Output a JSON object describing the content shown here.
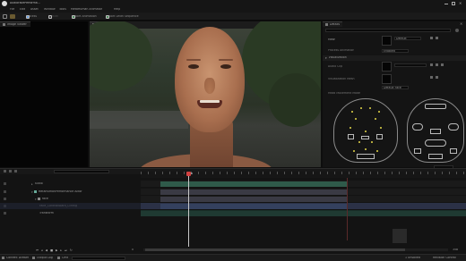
{
  "titlebar": {
    "tab_label": "AudioFacePerforma..."
  },
  "menu": {
    "items": [
      "File",
      "Edit",
      "Asset",
      "Window",
      "Tools",
      "MetaHuman Animator",
      "Help"
    ]
  },
  "toolbar": {
    "buttons": [
      {
        "label": "Process",
        "color": "#6aa0e0"
      },
      {
        "label": "Cancel",
        "color": "#555555"
      },
      {
        "label": "Export Animation",
        "color": "#9a9a9a"
      },
      {
        "label": "Export Level Sequence",
        "color": "#9a9a9a"
      }
    ]
  },
  "panels": {
    "image_viewer": "Image Viewer",
    "viewport": "A/B Viewport",
    "details": "Details"
  },
  "details": {
    "rows": [
      {
        "label": "Mesh",
        "value": "Default"
      },
      {
        "label": "Process Animation",
        "value": "Enabled"
      },
      {
        "label": "Visualization",
        "value": ""
      },
      {
        "label": "Audio Clip",
        "value": ""
      },
      {
        "label": "Visualization Mesh",
        "value": "Default Face"
      },
      {
        "label": "Head Movement Mode",
        "value": ""
      }
    ],
    "section": "Visualization"
  },
  "sequencer": {
    "frame_marker": "0",
    "tracks": [
      {
        "label": "Audio"
      },
      {
        "label": "MetaHumanPerformance Actor"
      },
      {
        "label": "Face"
      },
      {
        "label": "Face_ControlBoard_CtrlRig"
      },
      {
        "label": "Transform"
      }
    ],
    "start_frame": "0",
    "end_frame": "358"
  },
  "status": {
    "items": [
      "Content Drawer",
      "Output Log",
      "Cmd"
    ],
    "right": [
      "1 Unsaved",
      "Revision Control"
    ]
  },
  "colors": {
    "accent": "#6aa0e0",
    "playhead": "#d04040",
    "track_teal": "#2f5a4a",
    "track_blue": "#34405e"
  }
}
